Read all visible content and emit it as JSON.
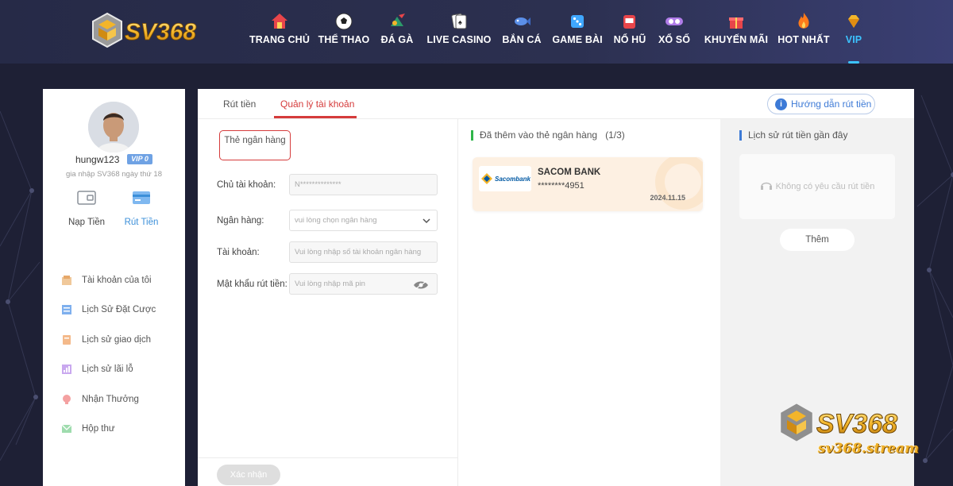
{
  "brand": {
    "logo_text": "SV368",
    "watermark_url": "sv368.stream"
  },
  "nav": {
    "items": [
      {
        "label": "TRANG CHỦ",
        "icon": "home-icon"
      },
      {
        "label": "THỂ THAO",
        "icon": "soccer-ball-icon"
      },
      {
        "label": "ĐÁ GÀ",
        "icon": "rooster-icon"
      },
      {
        "label": "LIVE CASINO",
        "icon": "playing-cards-icon"
      },
      {
        "label": "BẮN CÁ",
        "icon": "fish-icon"
      },
      {
        "label": "GAME BÀI",
        "icon": "dice-icon"
      },
      {
        "label": "NỔ HŨ",
        "icon": "slot-machine-icon"
      },
      {
        "label": "XỔ SỐ",
        "icon": "lottery-ball-icon"
      },
      {
        "label": "KHUYẾN MÃI",
        "icon": "gift-icon"
      },
      {
        "label": "HOT NHẤT",
        "icon": "fire-icon"
      },
      {
        "label": "VIP",
        "icon": "diamond-icon"
      }
    ],
    "active": "VIP"
  },
  "profile": {
    "username": "hungw123",
    "vip": "VIP 0",
    "joined": "gia nhập SV368 ngày thứ 18",
    "deposit_label": "Nạp Tiền",
    "withdraw_label": "Rút Tiền"
  },
  "menu": {
    "items": [
      {
        "label": "Tài khoản của tôi",
        "icon": "account-icon"
      },
      {
        "label": "Lịch Sử Đặt Cược",
        "icon": "bet-history-icon"
      },
      {
        "label": "Lịch sử giao dịch",
        "icon": "transaction-icon"
      },
      {
        "label": "Lịch sử lãi lỗ",
        "icon": "profit-loss-icon"
      },
      {
        "label": "Nhận Thưởng",
        "icon": "reward-icon"
      },
      {
        "label": "Hộp thư",
        "icon": "mailbox-icon"
      }
    ]
  },
  "tabs": {
    "withdraw": "Rút tiền",
    "manage": "Quản lý tài khoản",
    "guide": "Hướng dẫn rút tiền"
  },
  "form": {
    "card_type": "Thẻ ngân hàng",
    "holder_label": "Chủ tài khoản:",
    "holder_value": "N**************",
    "bank_label": "Ngân hàng:",
    "bank_placeholder": "vui lòng chọn ngân hàng",
    "account_label": "Tài khoản:",
    "account_placeholder": "Vui lòng nhập số tài khoản ngân hàng",
    "pin_label": "Mật khẩu rút tiền:",
    "pin_placeholder": "Vui lòng nhập mã pin",
    "confirm": "Xác nhận"
  },
  "bank_cards": {
    "title": "Đã thêm vào thẻ ngân hàng",
    "count": "(1/3)",
    "cards": [
      {
        "bank": "SACOM BANK",
        "logo_text": "Sacombank",
        "number": "********4951",
        "date": "2024.11.15"
      }
    ]
  },
  "history": {
    "title": "Lịch sử rút tiền gần đây",
    "empty": "Không có yêu cầu rút tiền",
    "add": "Thêm"
  },
  "colors": {
    "accent_red": "#d53b3b",
    "accent_blue": "#3d7ad6",
    "nav_active": "#3cc3ff",
    "green_bar": "#2fb54a",
    "blue_bar": "#3d7ad6"
  }
}
